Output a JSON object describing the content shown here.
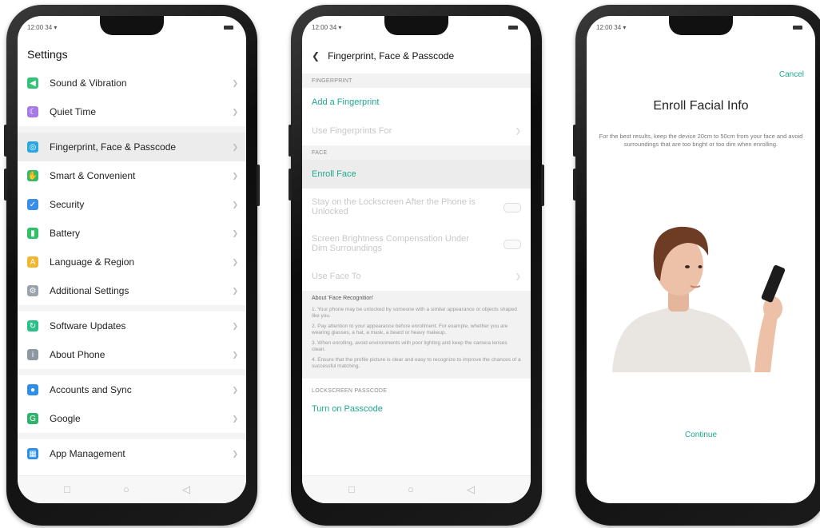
{
  "status": {
    "time": "12:00 34"
  },
  "screen1": {
    "title": "Settings",
    "groups": [
      [
        {
          "label": "Sound & Vibration",
          "icon": "speaker-icon",
          "color": "#34c27a"
        },
        {
          "label": "Quiet Time",
          "icon": "moon-icon",
          "color": "#a77be6"
        }
      ],
      [
        {
          "label": "Fingerprint, Face & Passcode",
          "icon": "fingerprint-icon",
          "color": "#2aa6e0",
          "selected": true
        },
        {
          "label": "Smart & Convenient",
          "icon": "hand-icon",
          "color": "#31bb6d"
        },
        {
          "label": "Security",
          "icon": "shield-icon",
          "color": "#3b8ee8"
        },
        {
          "label": "Battery",
          "icon": "battery-icon",
          "color": "#2fc16a"
        },
        {
          "label": "Language & Region",
          "icon": "language-icon",
          "color": "#f2b62e"
        },
        {
          "label": "Additional Settings",
          "icon": "gear-icon",
          "color": "#9aa3ad"
        }
      ],
      [
        {
          "label": "Software Updates",
          "icon": "update-icon",
          "color": "#2dbf8b"
        },
        {
          "label": "About Phone",
          "icon": "info-icon",
          "color": "#8e98a3"
        }
      ],
      [
        {
          "label": "Accounts and Sync",
          "icon": "person-icon",
          "color": "#2f8fe6"
        },
        {
          "label": "Google",
          "icon": "google-icon",
          "color": "#2fb36a"
        }
      ],
      [
        {
          "label": "App Management",
          "icon": "apps-icon",
          "color": "#2f8fe6"
        }
      ]
    ]
  },
  "screen2": {
    "title": "Fingerprint, Face & Passcode",
    "fingerprint_section": "FINGERPRINT",
    "add_fingerprint": "Add a Fingerprint",
    "use_fingerprints_for": "Use Fingerprints For",
    "face_section": "FACE",
    "enroll_face": "Enroll Face",
    "stay_on_lockscreen": "Stay on the Lockscreen After the Phone is Unlocked",
    "screen_brightness": "Screen Brightness Compensation Under Dim Surroundings",
    "use_face_to": "Use Face To",
    "about_title": "About 'Face Recognition'",
    "about_items": [
      "1. Your phone may be unlocked by someone with a similar appearance or objects shaped like you.",
      "2. Pay attention to your appearance before enrollment. For example, whether you are wearing glasses, a hat, a mask, a beard or heavy makeup.",
      "3. When enrolling, avoid environments with poor lighting and keep the camera lenses clean.",
      "4. Ensure that the profile picture is clear and easy to recognize to improve the chances of a successful matching."
    ],
    "lockscreen_section": "LOCKSCREEN PASSCODE",
    "turn_on_passcode": "Turn on Passcode"
  },
  "screen3": {
    "cancel": "Cancel",
    "title": "Enroll Facial Info",
    "description": "For the best results, keep the device 20cm to 50cm from your face and avoid surroundings that are too bright or too dim when enrolling.",
    "continue": "Continue"
  },
  "colors": {
    "accent": "#1ea88f"
  }
}
